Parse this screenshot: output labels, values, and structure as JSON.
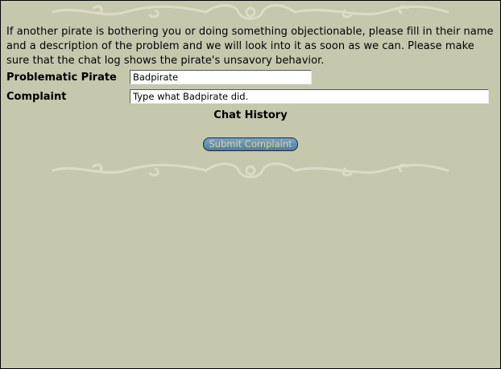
{
  "intro_text": "If another pirate is bothering you or doing something objectionable, please fill in their name and a description of the problem and we will look into it as soon as we can. Please make sure that the chat log shows the pirate's unsavory behavior.",
  "form": {
    "pirate_label": "Problematic Pirate",
    "pirate_value": "Badpirate",
    "complaint_label": "Complaint",
    "complaint_placeholder": "Type what Badpirate did."
  },
  "chat_history_title": "Chat History",
  "submit_label": "Submit Complaint",
  "colors": {
    "background": "#c6c8ae",
    "ornament": "#dcdcc6",
    "button": "#5b88ad",
    "button_text": "#e3d68a"
  }
}
